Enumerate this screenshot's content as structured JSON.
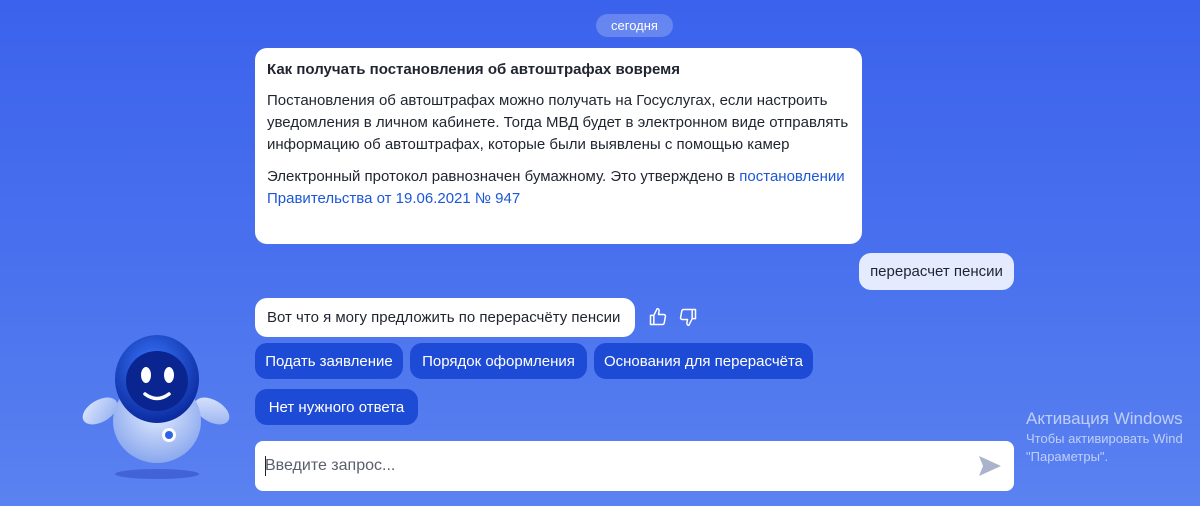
{
  "chat": {
    "date_label": "сегодня",
    "bot_message": {
      "title": "Как получать постановления об автоштрафах вовремя",
      "paragraph1": "Постановления об автоштрафах можно получать на Госуслугах, если настроить уведомления в личном кабинете. Тогда МВД будет в электронном виде отправлять информацию об автоштрафах, которые были выявлены с помощью камер",
      "paragraph2_text": "Электронный протокол равнозначен бумажному. Это утверждено в",
      "paragraph2_link": "постановлении Правительства от 19.06.2021 № 947"
    },
    "user_message": "перерасчет пенсии",
    "bot_reply": "Вот что я могу предложить по перерасчёту пенсии",
    "feedback_icons": [
      "thumbs-up-icon",
      "thumbs-down-icon"
    ],
    "quick_replies": [
      "Подать заявление",
      "Порядок оформления",
      "Основания для перерасчёта",
      "Нет нужного ответа"
    ]
  },
  "input": {
    "placeholder": "Введите запрос...",
    "value": ""
  },
  "send_icon": "send-arrow-icon",
  "assistant_avatar": "robot-assistant",
  "watermark": {
    "title": "Активация Windows",
    "line1": "Чтобы активировать Wind",
    "line2": "\"Параметры\"."
  },
  "colors": {
    "background": "#4169ed",
    "chip": "#1e4bd6",
    "link": "#1c57d8",
    "user_bubble": "#e4ebff"
  }
}
